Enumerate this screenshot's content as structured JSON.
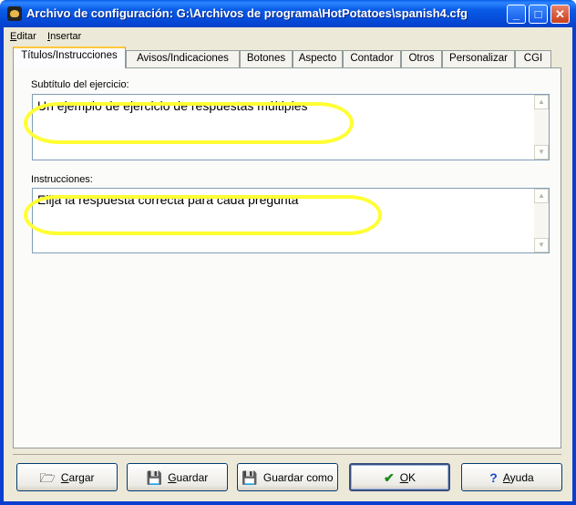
{
  "window": {
    "title": "Archivo de configuración: G:\\Archivos de programa\\HotPotatoes\\spanish4.cfg",
    "minimize_glyph": "_",
    "maximize_glyph": "□",
    "close_glyph": "✕"
  },
  "menu": {
    "items": [
      "Editar",
      "Insertar"
    ]
  },
  "tabs": [
    {
      "label": "Títulos/Instrucciones",
      "active": true
    },
    {
      "label": "Avisos/Indicaciones",
      "active": false
    },
    {
      "label": "Botones",
      "active": false
    },
    {
      "label": "Aspecto",
      "active": false
    },
    {
      "label": "Contador",
      "active": false
    },
    {
      "label": "Otros",
      "active": false
    },
    {
      "label": "Personalizar",
      "active": false
    },
    {
      "label": "CGI",
      "active": false
    }
  ],
  "fields": {
    "subtitle": {
      "label": "Subtítulo del ejercicio:",
      "value": "Un ejemplo de ejercicio de respuestas múltiples"
    },
    "instructions": {
      "label": "Instrucciones:",
      "value": "Elija la respuesta correcta para cada pregunta"
    }
  },
  "buttons": {
    "load": "Cargar",
    "save": "Guardar",
    "save_as": "Guardar como",
    "ok": "OK",
    "help": "Ayuda"
  },
  "icons": {
    "load": "folder-icon",
    "save": "floppy-icon",
    "save_as": "floppy-icon",
    "ok": "checkmark-icon",
    "help": "question-icon"
  },
  "colors": {
    "titlebar": "#0a5ce8",
    "face": "#ece9d8",
    "highlight": "#ffff33",
    "ok_check": "#1a8a1a",
    "help_q": "#1a4acf"
  }
}
